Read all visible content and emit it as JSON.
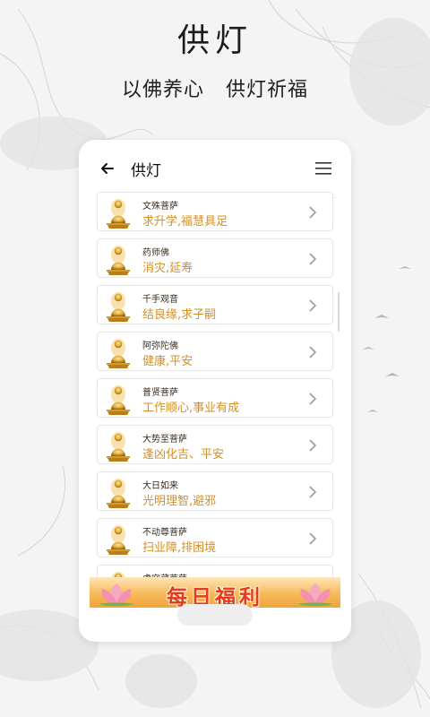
{
  "promo": {
    "title": "供灯",
    "tagline_left": "以佛养心",
    "tagline_right": "供灯祈福"
  },
  "header": {
    "back_icon": "back-arrow-icon",
    "title": "供灯",
    "menu_icon": "menu-icon"
  },
  "list": {
    "items": [
      {
        "name": "文殊菩萨",
        "blessing": "求升学,福慧具足",
        "icon": "buddha-statue-icon"
      },
      {
        "name": "药师佛",
        "blessing": "消灾,延寿",
        "icon": "buddha-statue-icon"
      },
      {
        "name": "千手观音",
        "blessing": "结良缘,求子嗣",
        "icon": "buddha-statue-icon"
      },
      {
        "name": "阿弥陀佛",
        "blessing": "健康,平安",
        "icon": "buddha-statue-icon"
      },
      {
        "name": "普贤菩萨",
        "blessing": "工作顺心,事业有成",
        "icon": "buddha-statue-icon"
      },
      {
        "name": "大势至菩萨",
        "blessing": "逢凶化吉、平安",
        "icon": "buddha-statue-icon"
      },
      {
        "name": "大日如来",
        "blessing": "光明理智,避邪",
        "icon": "buddha-statue-icon"
      },
      {
        "name": "不动尊菩萨",
        "blessing": "扫业障,排困境",
        "icon": "buddha-statue-icon"
      },
      {
        "name": "虚空藏菩萨",
        "blessing": "",
        "icon": "buddha-statue-icon"
      }
    ]
  },
  "banner": {
    "text": "每日福利",
    "icon": "lotus-icon"
  },
  "colors": {
    "accent_gold": "#d58f22",
    "banner_orange": "#f0a43c",
    "banner_text_red": "#e23b1f"
  }
}
